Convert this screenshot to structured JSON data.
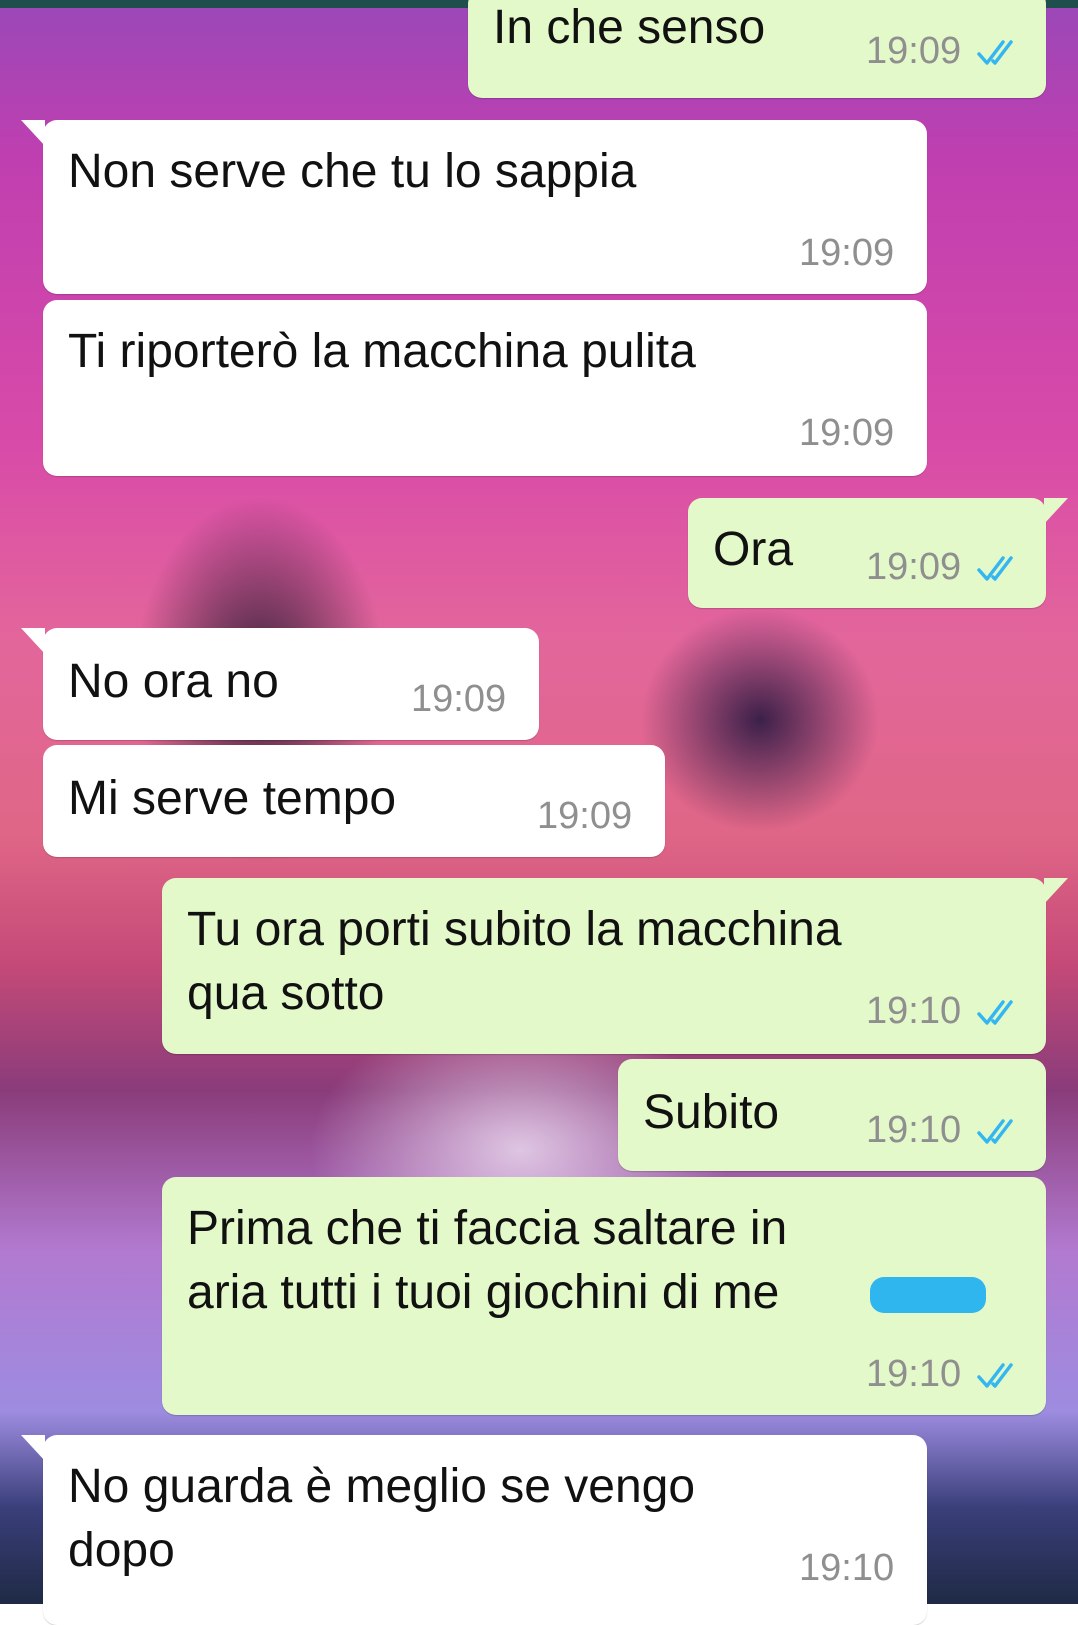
{
  "chat": {
    "messages": [
      {
        "dir": "out",
        "text": "In che senso",
        "time": "19:09",
        "ticks": "double-check-icon"
      },
      {
        "dir": "in",
        "text": "Non serve che tu lo sappia",
        "time": "19:09"
      },
      {
        "dir": "in",
        "text": "Ti riporterò la macchina pulita",
        "time": "19:09"
      },
      {
        "dir": "out",
        "text": "Ora",
        "time": "19:09",
        "ticks": "double-check-icon"
      },
      {
        "dir": "in",
        "text": "No ora no",
        "time": "19:09"
      },
      {
        "dir": "in",
        "text": "Mi serve tempo",
        "time": "19:09"
      },
      {
        "dir": "out",
        "lines": [
          "Tu ora porti subito la macchina",
          "qua sotto"
        ],
        "time": "19:10",
        "ticks": "double-check-icon"
      },
      {
        "dir": "out",
        "text": "Subito",
        "time": "19:10",
        "ticks": "double-check-icon"
      },
      {
        "dir": "out",
        "lines": [
          "Prima che ti faccia saltare in",
          "aria tutti i tuoi giochini di me"
        ],
        "time": "19:10",
        "ticks": "double-check-icon",
        "redacted": true
      },
      {
        "dir": "in",
        "lines": [
          "No guarda è meglio se vengo",
          "dopo"
        ],
        "time": "19:10"
      }
    ]
  },
  "colors": {
    "incoming_bubble": "#ffffff",
    "outgoing_bubble": "#e4f9c9",
    "read_ticks": "#34b7f1",
    "timestamp": "#8f8f8f",
    "redaction": "#2fb6ee"
  }
}
